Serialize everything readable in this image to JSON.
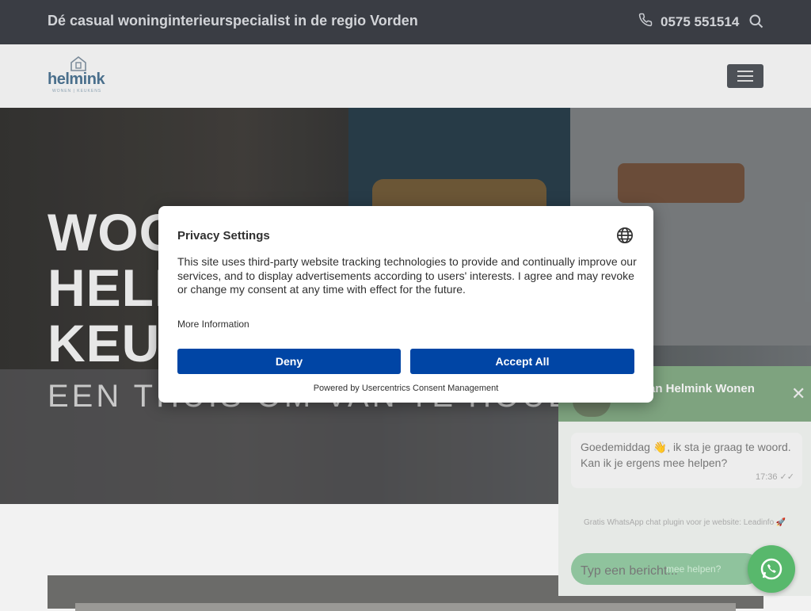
{
  "topbar": {
    "tagline": "Dé casual woninginterieurspecialist in de regio Vorden",
    "phone": "0575 551514",
    "phone_icon": "phone-icon",
    "search_icon": "search-icon"
  },
  "navbar": {
    "logo_text": "helmink",
    "logo_sub": "WONEN | KEUKENS",
    "menu_icon": "hamburger-icon"
  },
  "hero": {
    "title_line1": "WOO",
    "title_line2": "HELI",
    "title_line3": "KEUI",
    "subtitle": "EEN THUIS OM VAN TE HOUDEN"
  },
  "chat": {
    "title": "en van Helmink Wonen",
    "message": "Goedemiddag 👋, ik sta je graag te woord. Kan ik je ergens mee helpen?",
    "time": "17:36 ✓✓",
    "plugin_text": "Gratis WhatsApp chat plugin voor je website: Leadinfo 🚀",
    "input_placeholder": "Typ een bericht...",
    "cta": "mee helpen?"
  },
  "modal": {
    "title": "Privacy Settings",
    "body": "This site uses third-party website tracking technologies to provide and continually improve our services, and to display advertisements according to users' interests. I agree and may revoke or change my consent at any time with effect for the future.",
    "more_info": "More Information",
    "deny": "Deny",
    "accept": "Accept All",
    "powered_by": "Powered by Usercentrics Consent Management"
  },
  "colors": {
    "topbar": "#3a3d44",
    "button_blue": "#0045a5",
    "whatsapp_green": "#58b86c"
  }
}
